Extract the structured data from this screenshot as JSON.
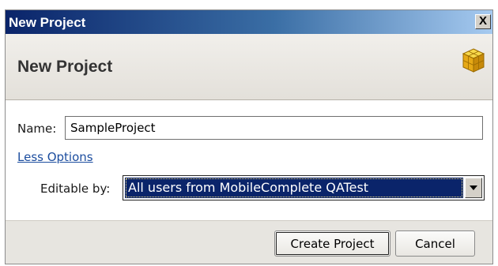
{
  "window": {
    "title": "New Project",
    "close_label": "X"
  },
  "header": {
    "heading": "New Project",
    "icon": "cube-icon"
  },
  "form": {
    "name_label": "Name:",
    "name_value": "SampleProject",
    "less_options": "Less Options",
    "editable_label": "Editable by:",
    "editable_value": "All users from MobileComplete QATest"
  },
  "buttons": {
    "create": "Create Project",
    "cancel": "Cancel"
  },
  "colors": {
    "selection": "#0a246a",
    "link": "#1b4c9e",
    "title_gradient_start": "#0a246a"
  }
}
